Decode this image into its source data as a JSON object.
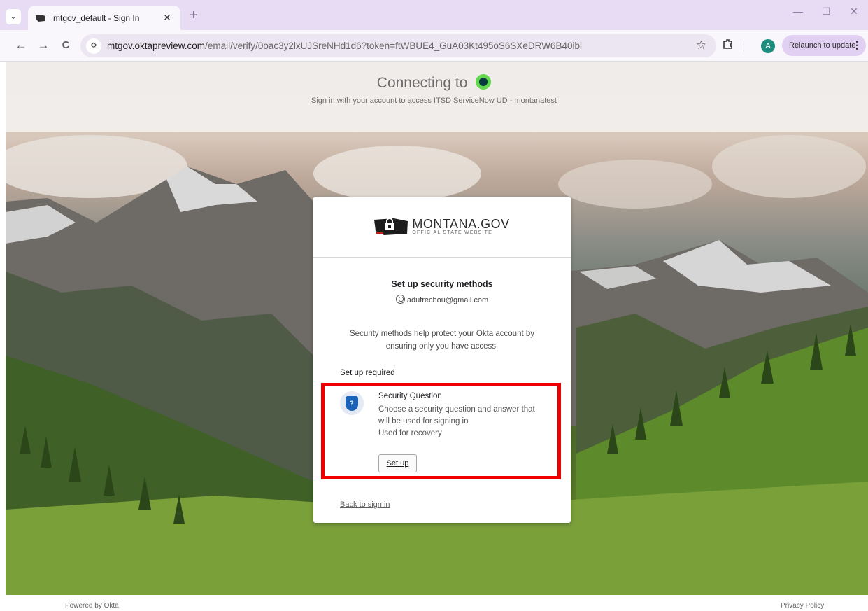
{
  "browser": {
    "tab_title": "mtgov_default - Sign In",
    "tab_close": "✕",
    "new_tab": "+",
    "url_domain": "mtgov.oktapreview.com",
    "url_path": "/email/verify/0oac3y2lxUJSreNHd1d6?token=ftWBUE4_GuA03Kt495oS6SXeDRW6B40ibl",
    "avatar_letter": "A",
    "relaunch_label": "Relaunch to update",
    "menu_dots": "⋮",
    "back": "←",
    "forward": "→",
    "reload": "C",
    "star": "☆",
    "minimize": "—",
    "maximize": "☐",
    "close": "✕"
  },
  "header": {
    "connecting_to": "Connecting to",
    "subtitle": "Sign in with your account to access ITSD ServiceNow UD - montanatest"
  },
  "card": {
    "logo_text": "MONTANA.GOV",
    "logo_subtext": "OFFICIAL STATE WEBSITE",
    "heading": "Set up security methods",
    "user_email": "adufrechou@gmail.com",
    "description": "Security methods help protect your Okta account by ensuring only you have access.",
    "required_label": "Set up required",
    "method": {
      "title": "Security Question",
      "description": "Choose a security question and answer that will be used for signing in",
      "usage": "Used for recovery",
      "setup_button": "Set up"
    },
    "back_link": "Back to sign in"
  },
  "footer": {
    "powered_by": "Powered by Okta",
    "privacy": "Privacy Policy"
  },
  "colors": {
    "highlight": "#ee0000",
    "shield": "#1a63b8",
    "okta_green": "#62d84e"
  }
}
